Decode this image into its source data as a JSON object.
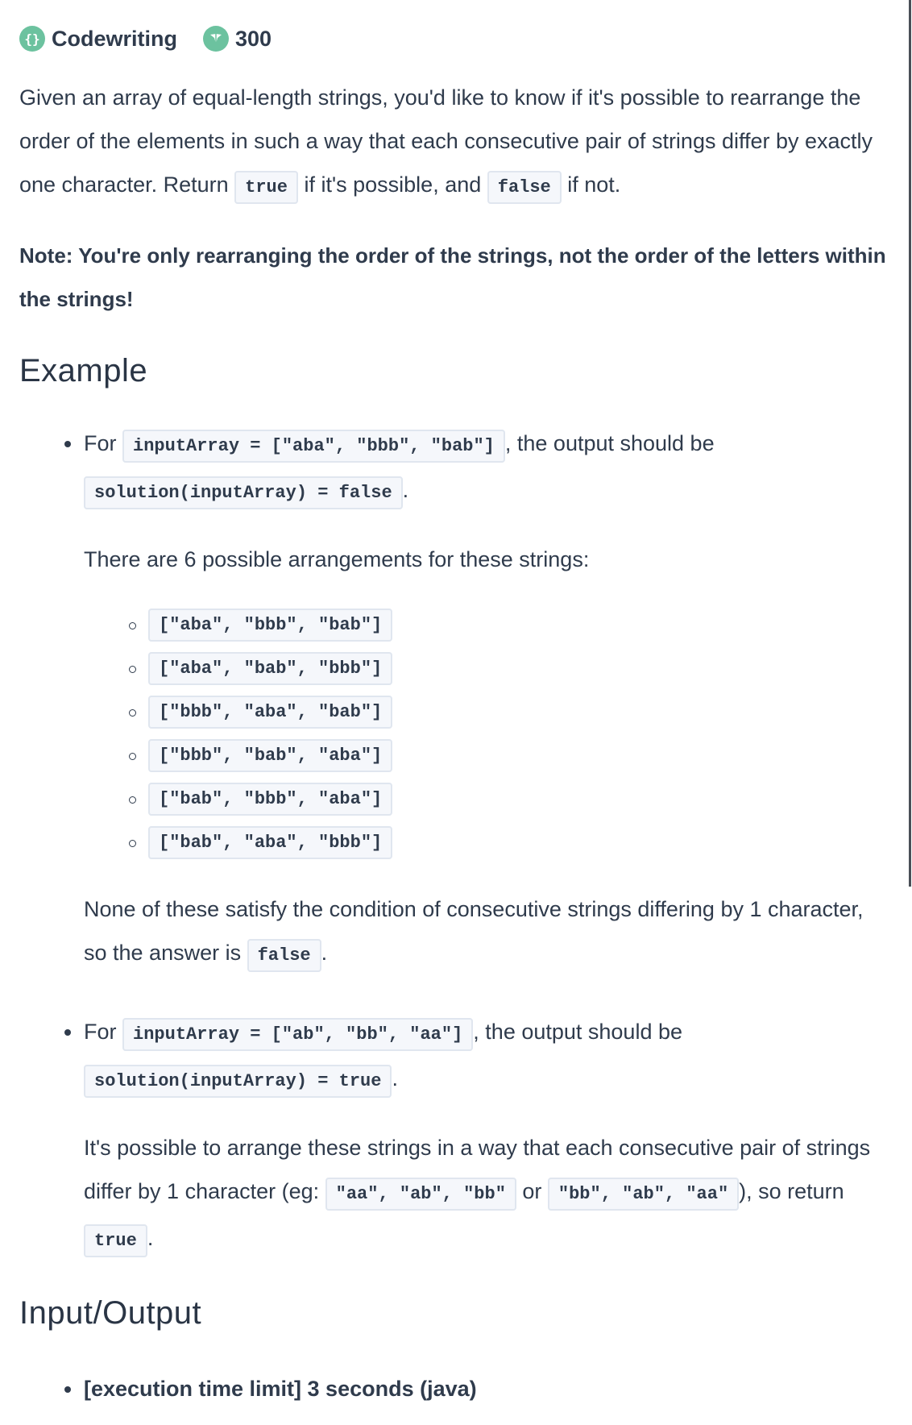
{
  "header": {
    "category_icon": "curly-braces-icon",
    "category": "Codewriting",
    "points_icon": "coin-icon",
    "points": "300"
  },
  "description": {
    "part1": "Given an array of equal-length strings, you'd like to know if it's possible to rearrange the order of the elements in such a way that each consecutive pair of strings differ by exactly one character. Return ",
    "code_true": "true",
    "part2": " if it's possible, and ",
    "code_false": "false",
    "part3": " if not."
  },
  "note": "Note: You're only rearranging the order of the strings, not the order of the letters within the strings!",
  "example_heading": "Example",
  "example1": {
    "prefix": "For ",
    "input_code": "inputArray = [\"aba\", \"bbb\", \"bab\"]",
    "middle": ", the output should be",
    "output_code": "solution(inputArray) = false",
    "suffix": ".",
    "arrangements_intro": "There are 6 possible arrangements for these strings:",
    "arrangements": [
      "[\"aba\", \"bbb\", \"bab\"]",
      "[\"aba\", \"bab\", \"bbb\"]",
      "[\"bbb\", \"aba\", \"bab\"]",
      "[\"bbb\", \"bab\", \"aba\"]",
      "[\"bab\", \"bbb\", \"aba\"]",
      "[\"bab\", \"aba\", \"bbb\"]"
    ],
    "conclusion_text": "None of these satisfy the condition of consecutive strings differing by 1 character, so the answer is ",
    "conclusion_code": "false",
    "conclusion_suffix": "."
  },
  "example2": {
    "prefix": "For ",
    "input_code": "inputArray = [\"ab\", \"bb\", \"aa\"]",
    "middle": ", the output should be",
    "output_code": "solution(inputArray) = true",
    "suffix": ".",
    "explain_part1": "It's possible to arrange these strings in a way that each consecutive pair of strings differ by 1 character (eg: ",
    "explain_code1": "\"aa\", \"ab\", \"bb\"",
    "explain_or": " or ",
    "explain_code2": "\"bb\", \"ab\", \"aa\"",
    "explain_part2": "), so return ",
    "explain_code3": "true",
    "explain_suffix": "."
  },
  "io_heading": "Input/Output",
  "io_items": [
    "[execution time limit] 3 seconds (java)"
  ]
}
